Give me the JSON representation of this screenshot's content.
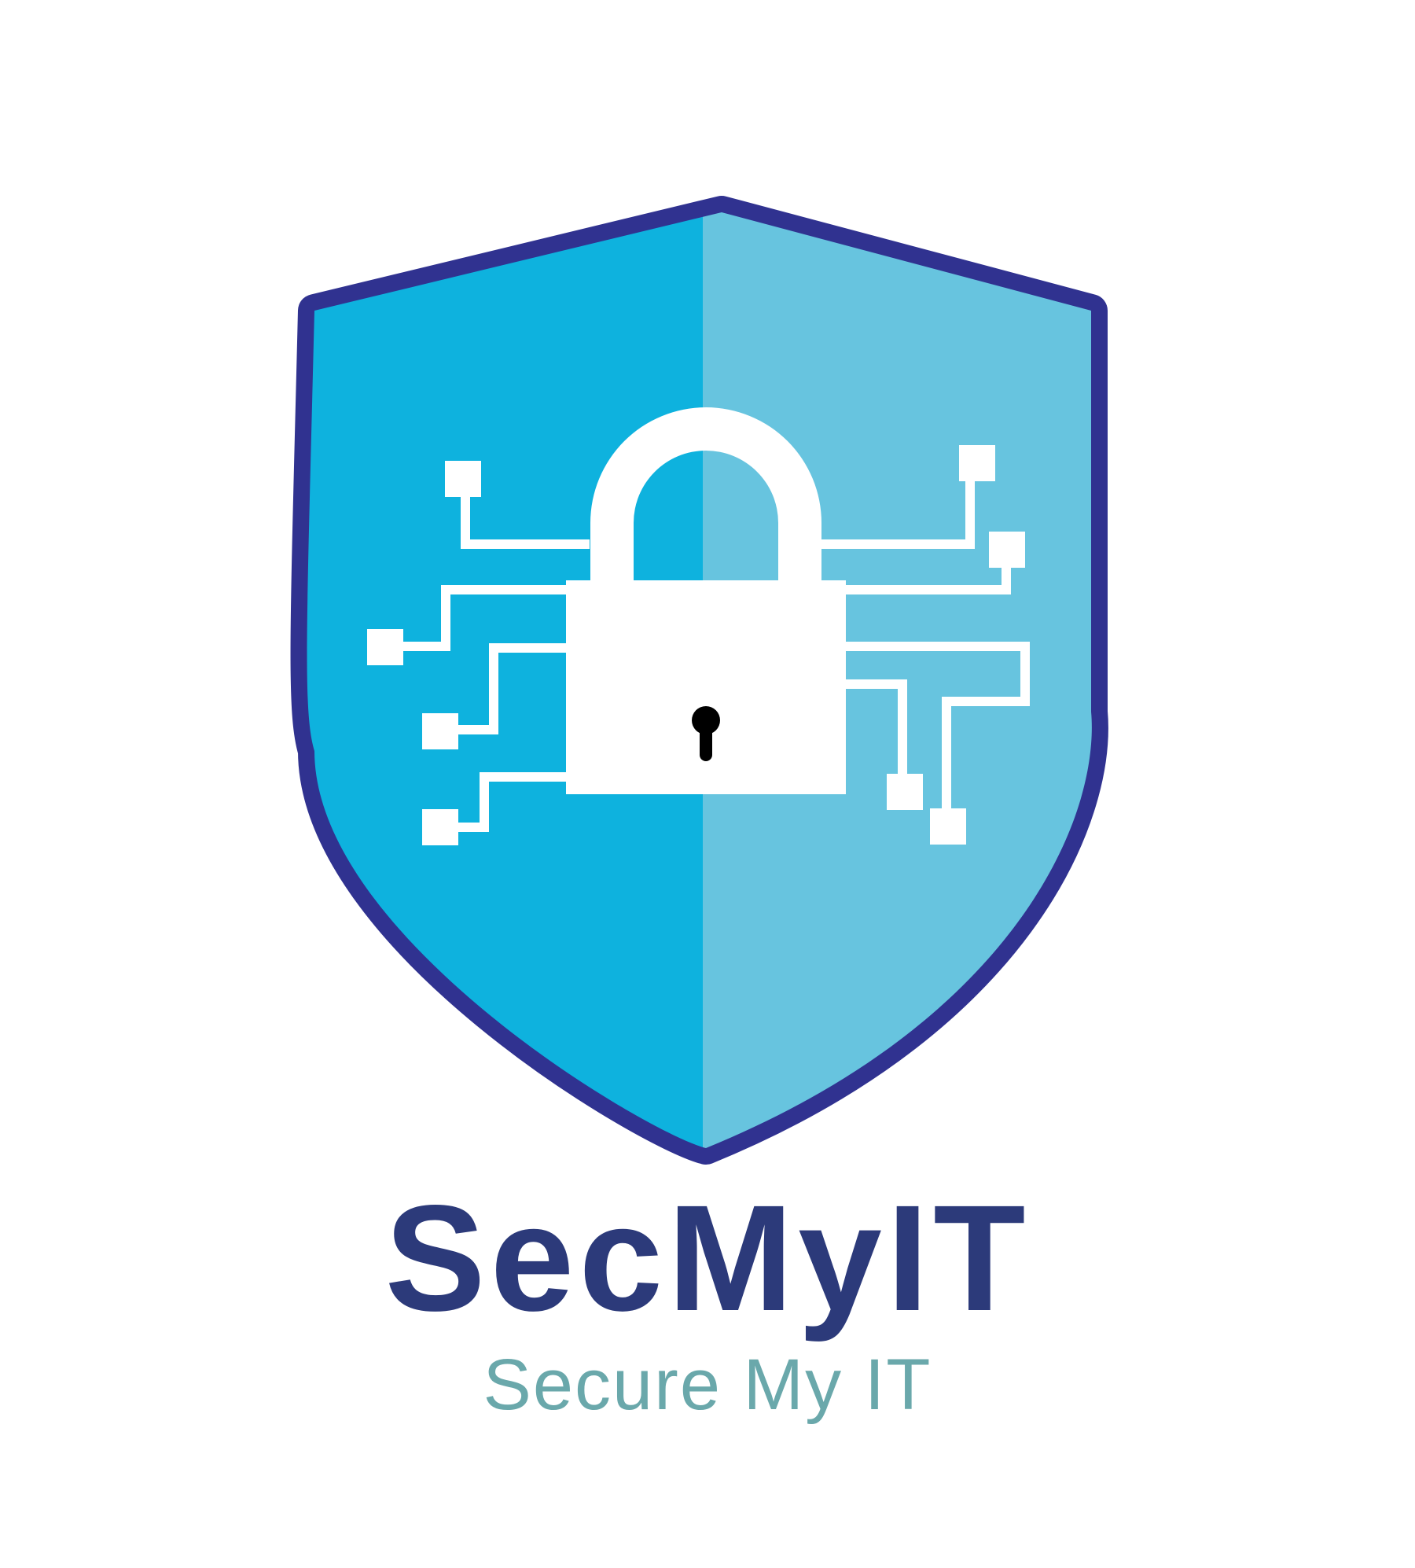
{
  "logo": {
    "brand_name": "SecMyIT",
    "tagline": "Secure My IT",
    "icon": "shield-padlock-circuit-icon"
  },
  "colors": {
    "shield_outline": "#303290",
    "shield_left": "#0eb2de",
    "shield_right": "#67c4df",
    "padlock": "#ffffff",
    "keyhole": "#000000",
    "brand_name": "#2c3a7a",
    "tagline": "#6aa8ab",
    "background": "#ffffff"
  }
}
